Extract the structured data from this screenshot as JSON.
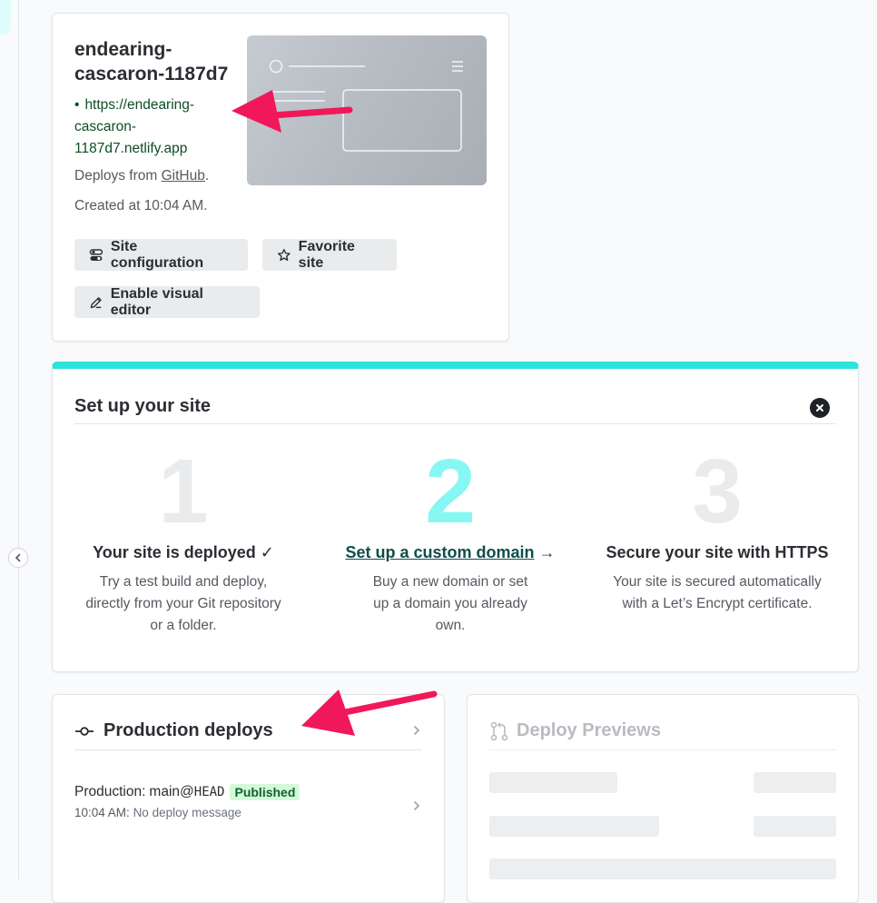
{
  "site": {
    "name": "endearing-cascaron-1187d7",
    "url": "https://endearing-cascaron-1187d7.netlify.app",
    "deploys_from_prefix": "Deploys from ",
    "deploys_from_link": "GitHub",
    "deploys_from_suffix": ".",
    "created_at": "Created at 10:04 AM."
  },
  "buttons": {
    "site_configuration": "Site configuration",
    "favorite_site": "Favorite site",
    "enable_visual_editor": "Enable visual editor"
  },
  "setup": {
    "title": "Set up your site",
    "steps": [
      {
        "number": "1",
        "title": "Your site is deployed ✓",
        "desc": "Try a test build and deploy, directly from your Git repository or a folder."
      },
      {
        "number": "2",
        "title": "Set up a custom domain",
        "arrow": "→",
        "desc": "Buy a new domain or set up a domain you already own."
      },
      {
        "number": "3",
        "title": "Secure your site with HTTPS",
        "desc": "Your site is secured automatically with a Let’s Encrypt certificate."
      }
    ]
  },
  "production": {
    "title": "Production deploys",
    "deploy": {
      "label": "Production:",
      "ref_prefix": "main@",
      "ref": "HEAD",
      "status": "Published",
      "time": "10:04 AM:",
      "message": "No deploy message"
    }
  },
  "previews": {
    "title": "Deploy Previews"
  },
  "colors": {
    "accent_teal": "#2be4dc",
    "step_active": "#86f7f3",
    "step_inactive": "#e9ebed",
    "url_green": "#0e4d24",
    "badge_bg": "#d3f9d8",
    "annotation_arrow": "#f0185a"
  },
  "icons": [
    "chevron-left-icon",
    "toggles-icon",
    "star-icon",
    "pencil-icon",
    "close-icon",
    "commit-icon",
    "chevron-right-icon",
    "git-pull-request-icon"
  ]
}
